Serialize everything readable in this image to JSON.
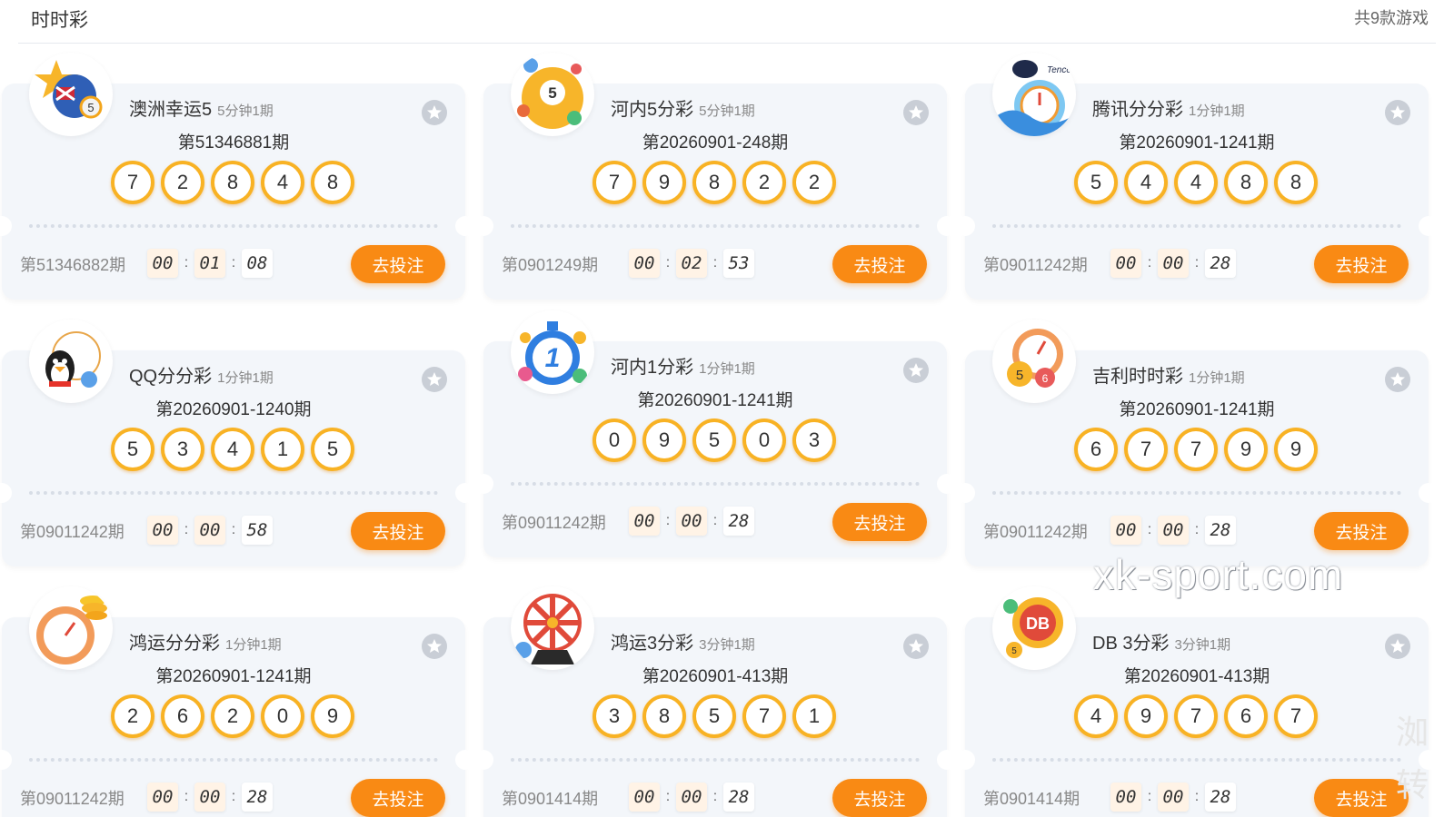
{
  "header": {
    "title": "时时彩",
    "count": "共9款游戏"
  },
  "bet_label": "去投注",
  "games": [
    {
      "name": "澳洲幸运5",
      "freq": "5分钟1期",
      "issue": "第51346881期",
      "balls": [
        "7",
        "2",
        "8",
        "4",
        "8"
      ],
      "next": "第51346882期",
      "timer": [
        "00",
        "01",
        "08"
      ],
      "icon": "australia-flag-ball-icon"
    },
    {
      "name": "河内5分彩",
      "freq": "5分钟1期",
      "issue": "第20260901-248期",
      "balls": [
        "7",
        "9",
        "8",
        "2",
        "2"
      ],
      "next": "第0901249期",
      "timer": [
        "00",
        "02",
        "53"
      ],
      "icon": "lottery-ball-5-icon"
    },
    {
      "name": "腾讯分分彩",
      "freq": "1分钟1期",
      "issue": "第20260901-1241期",
      "balls": [
        "5",
        "4",
        "4",
        "8",
        "8"
      ],
      "next": "第09011242期",
      "timer": [
        "00",
        "00",
        "28"
      ],
      "icon": "tencent-penguin-clock-icon",
      "icon_text": "Tencent"
    },
    {
      "name": "QQ分分彩",
      "freq": "1分钟1期",
      "issue": "第20260901-1240期",
      "balls": [
        "5",
        "3",
        "4",
        "1",
        "5"
      ],
      "next": "第09011242期",
      "timer": [
        "00",
        "00",
        "58"
      ],
      "icon": "qq-penguin-icon"
    },
    {
      "name": "河内1分彩",
      "freq": "1分钟1期",
      "issue": "第20260901-1241期",
      "balls": [
        "0",
        "9",
        "5",
        "0",
        "3"
      ],
      "next": "第09011242期",
      "timer": [
        "00",
        "00",
        "28"
      ],
      "icon": "stopwatch-1-icon"
    },
    {
      "name": "吉利时时彩",
      "freq": "1分钟1期",
      "issue": "第20260901-1241期",
      "balls": [
        "6",
        "7",
        "7",
        "9",
        "9"
      ],
      "next": "第09011242期",
      "timer": [
        "00",
        "00",
        "28"
      ],
      "icon": "clock-balls-icon"
    },
    {
      "name": "鸿运分分彩",
      "freq": "1分钟1期",
      "issue": "第20260901-1241期",
      "balls": [
        "2",
        "6",
        "2",
        "0",
        "9"
      ],
      "next": "第09011242期",
      "timer": [
        "00",
        "00",
        "28"
      ],
      "icon": "stopwatch-coins-icon"
    },
    {
      "name": "鸿运3分彩",
      "freq": "3分钟1期",
      "issue": "第20260901-413期",
      "balls": [
        "3",
        "8",
        "5",
        "7",
        "1"
      ],
      "next": "第0901414期",
      "timer": [
        "00",
        "00",
        "28"
      ],
      "icon": "prize-wheel-icon"
    },
    {
      "name": "DB 3分彩",
      "freq": "3分钟1期",
      "issue": "第20260901-413期",
      "balls": [
        "4",
        "9",
        "7",
        "6",
        "7"
      ],
      "next": "第0901414期",
      "timer": [
        "00",
        "00",
        "28"
      ],
      "icon": "db-ball-icon",
      "icon_text": "DB"
    }
  ],
  "watermark": "xk-sport.com",
  "corner_text": "洳转",
  "colors": {
    "accent": "#f98a14",
    "ball_border": "#f8b224",
    "card_bg": "#f3f6fa"
  }
}
